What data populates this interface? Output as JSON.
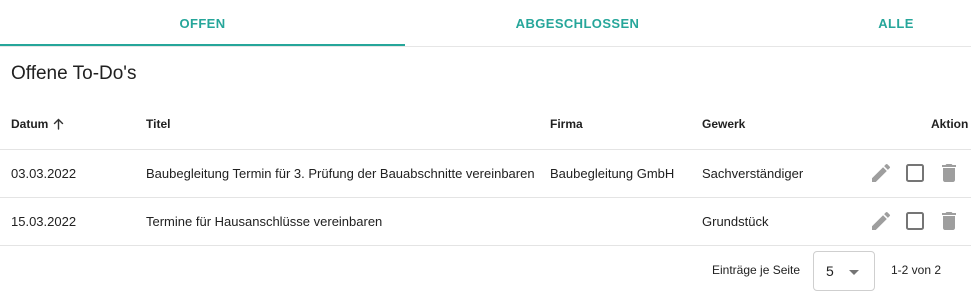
{
  "tabs": [
    {
      "label": "OFFEN",
      "active": true
    },
    {
      "label": "ABGESCHLOSSEN",
      "active": false
    },
    {
      "label": "ALLE",
      "active": false
    }
  ],
  "accent_color": "#26a69a",
  "page_title": "Offene To-Do's",
  "table": {
    "columns": {
      "date": "Datum",
      "title": "Titel",
      "firm": "Firma",
      "trade": "Gewerk",
      "action": "Aktion"
    },
    "sort": {
      "column": "Datum",
      "direction": "ascending",
      "icon": "arrow-up-icon"
    },
    "rows": [
      {
        "date": "03.03.2022",
        "title": "Baubegleitung Termin für 3. Prüfung der Bauabschnitte vereinbaren",
        "firm": "Baubegleitung GmbH",
        "trade": "Sachverständiger",
        "done": false
      },
      {
        "date": "15.03.2022",
        "title": "Termine für Hausanschlüsse vereinbaren",
        "firm": "",
        "trade": "Grundstück",
        "done": false
      }
    ],
    "row_actions": [
      "pencil-icon",
      "checkbox-icon",
      "trash-icon"
    ]
  },
  "pagination": {
    "rows_per_page_label": "Einträge je Seite",
    "rows_per_page": "5",
    "range": "1-2 von 2"
  }
}
